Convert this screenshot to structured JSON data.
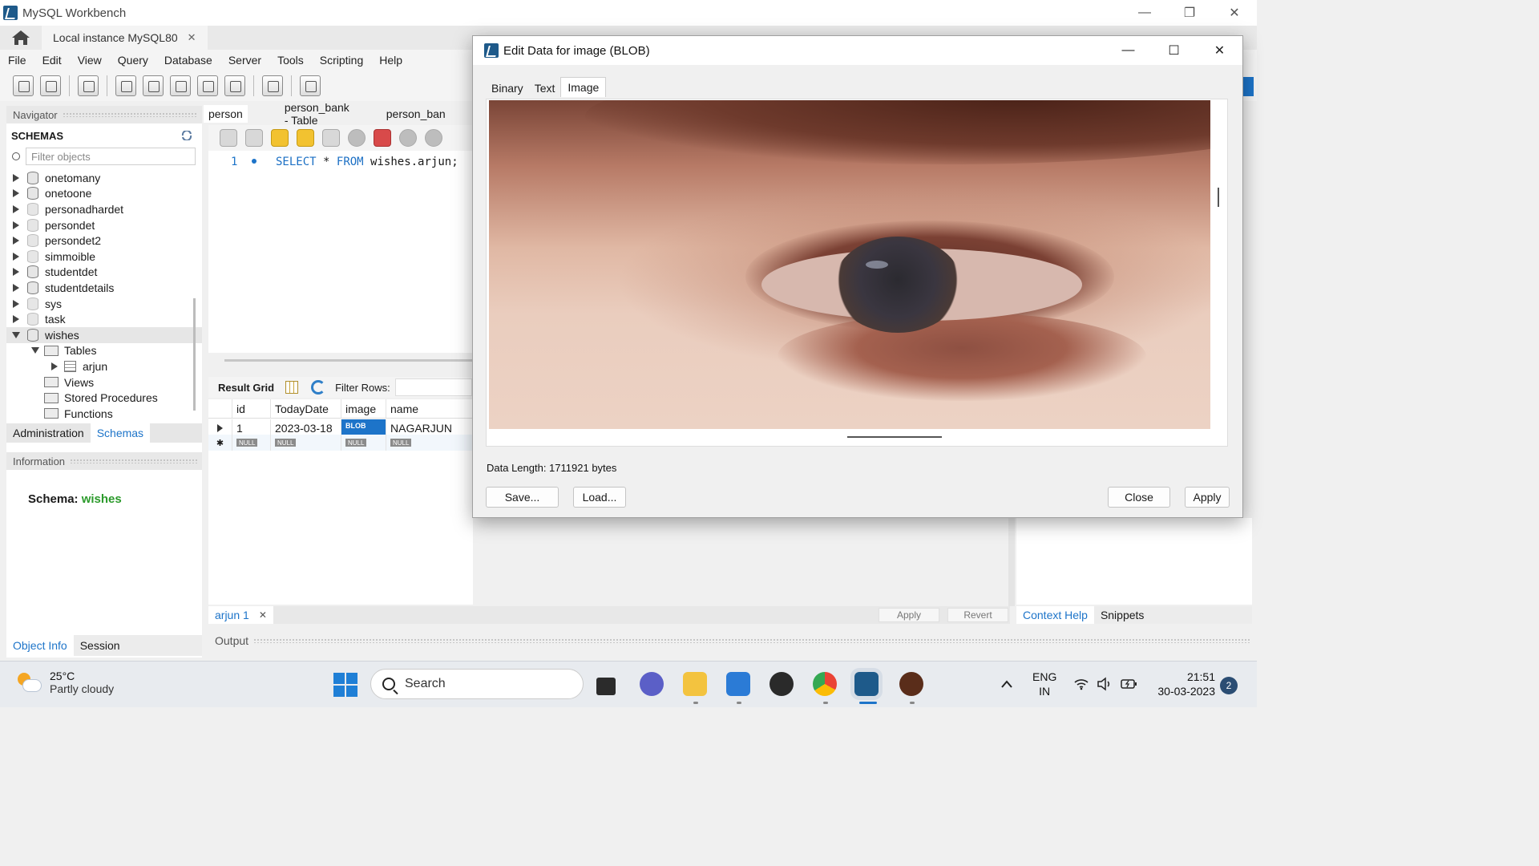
{
  "window": {
    "title": "MySQL Workbench",
    "minimize": "—",
    "restore": "❐",
    "close": "✕"
  },
  "connection_tab": {
    "label": "Local instance MySQL80",
    "close": "✕"
  },
  "menu": [
    "File",
    "Edit",
    "View",
    "Query",
    "Database",
    "Server",
    "Tools",
    "Scripting",
    "Help"
  ],
  "navigator": {
    "header": "Navigator",
    "schemas_label": "SCHEMAS",
    "filter_placeholder": "Filter objects",
    "schemas": [
      "onetomany",
      "onetoone",
      "personadhardet",
      "persondet",
      "persondet2",
      "simmoible",
      "studentdet",
      "studentdetails",
      "sys",
      "task",
      "wishes"
    ],
    "wishes_children": {
      "tables": "Tables",
      "table_arjun": "arjun",
      "views": "Views",
      "procedures": "Stored Procedures",
      "functions": "Functions"
    },
    "tab_admin": "Administration",
    "tab_schemas": "Schemas",
    "info_header": "Information",
    "schema_label": "Schema:",
    "schema_value": "wishes",
    "tab_object_info": "Object Info",
    "tab_session": "Session"
  },
  "editor": {
    "tabs": [
      "person",
      "person_bank - Table",
      "person_ban"
    ],
    "line_number": "1",
    "sql_kw1": "SELECT",
    "sql_star": "*",
    "sql_kw2": "FROM",
    "sql_rest": "wishes.arjun;"
  },
  "result": {
    "result_grid": "Result Grid",
    "filter_rows": "Filter Rows:",
    "columns": [
      "id",
      "TodayDate",
      "image",
      "name"
    ],
    "row": {
      "id": "1",
      "date": "2023-03-18",
      "image": "BLOB",
      "name": "NAGARJUN"
    },
    "null_label": "NULL",
    "new_row_marker": "✱",
    "tab_label": "arjun 1",
    "tab_close": "✕",
    "apply": "Apply",
    "revert": "Revert"
  },
  "context": {
    "help": "Context Help",
    "snippets": "Snippets"
  },
  "output": {
    "label": "Output"
  },
  "dialog": {
    "title": "Edit Data for image (BLOB)",
    "minimize": "—",
    "maximize": "☐",
    "close": "✕",
    "tabs": [
      "Binary",
      "Text",
      "Image"
    ],
    "data_length": "Data Length: 1711921 bytes",
    "save": "Save...",
    "load": "Load...",
    "close_btn": "Close",
    "apply": "Apply"
  },
  "taskbar": {
    "temperature": "25°C",
    "weather": "Partly cloudy",
    "search": "Search",
    "lang1": "ENG",
    "lang2": "IN",
    "time": "21:51",
    "date": "30-03-2023",
    "notifications": "2"
  },
  "colors": {
    "accent": "#1d74c9",
    "schema_value": "#2b9a2b",
    "blob_badge": "#1d74c9"
  }
}
